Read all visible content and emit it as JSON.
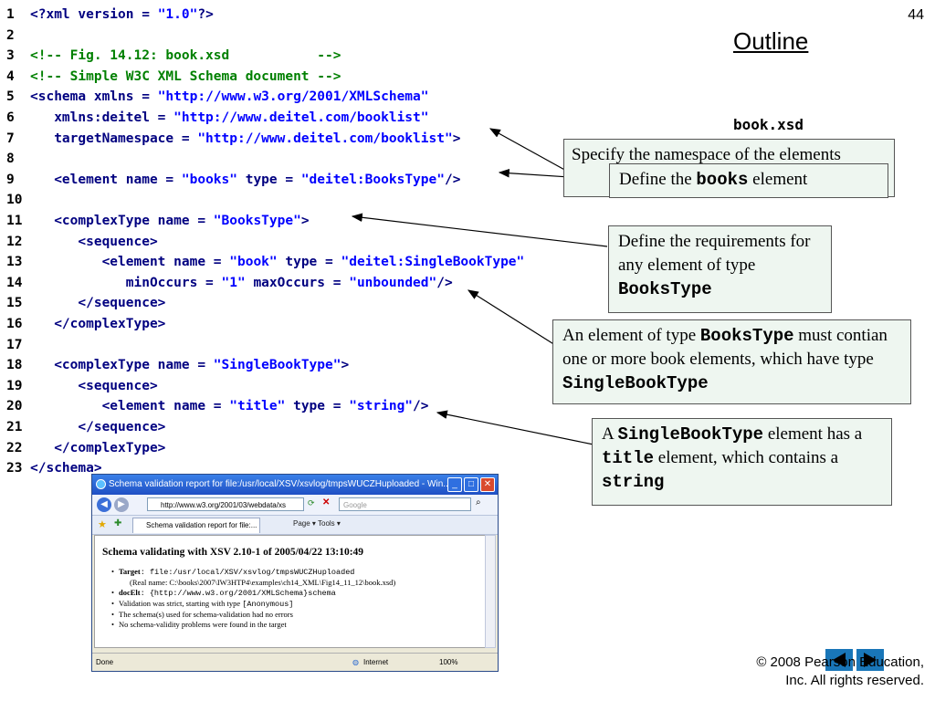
{
  "page_number": "44",
  "outline_title": "Outline",
  "file_name": "book.xsd",
  "code_lines": [
    {
      "n": "1",
      "t": "<?xml version = \"1.0\"?>"
    },
    {
      "n": "2",
      "t": ""
    },
    {
      "n": "3",
      "t": "<!-- Fig. 14.12: book.xsd           -->"
    },
    {
      "n": "4",
      "t": "<!-- Simple W3C XML Schema document -->"
    },
    {
      "n": "5",
      "t": "<schema xmlns = \"http://www.w3.org/2001/XMLSchema\""
    },
    {
      "n": "6",
      "t": "   xmlns:deitel = \"http://www.deitel.com/booklist\""
    },
    {
      "n": "7",
      "t": "   targetNamespace = \"http://www.deitel.com/booklist\">"
    },
    {
      "n": "8",
      "t": ""
    },
    {
      "n": "9",
      "t": "   <element name = \"books\" type = \"deitel:BooksType\"/>"
    },
    {
      "n": "10",
      "t": ""
    },
    {
      "n": "11",
      "t": "   <complexType name = \"BooksType\">"
    },
    {
      "n": "12",
      "t": "      <sequence>"
    },
    {
      "n": "13",
      "t": "         <element name = \"book\" type = \"deitel:SingleBookType\""
    },
    {
      "n": "14",
      "t": "            minOccurs = \"1\" maxOccurs = \"unbounded\"/>"
    },
    {
      "n": "15",
      "t": "      </sequence>"
    },
    {
      "n": "16",
      "t": "   </complexType>"
    },
    {
      "n": "17",
      "t": ""
    },
    {
      "n": "18",
      "t": "   <complexType name = \"SingleBookType\">"
    },
    {
      "n": "19",
      "t": "      <sequence>"
    },
    {
      "n": "20",
      "t": "         <element name = \"title\" type = \"string\"/>"
    },
    {
      "n": "21",
      "t": "      </sequence>"
    },
    {
      "n": "22",
      "t": "   </complexType>"
    },
    {
      "n": "23",
      "t": "</schema>"
    }
  ],
  "callouts": {
    "namespace": "Specify the namespace of the elements",
    "books_element": {
      "before": "Define the ",
      "code": "books",
      "after": " element"
    },
    "bookstype": {
      "before": "Define the requirements for any element of type ",
      "code": "BooksType"
    },
    "contain": {
      "p1": "An element of type ",
      "c1": "BooksType",
      "p2": " must contian one or more book elements, which have type ",
      "c2": "SingleBookType"
    },
    "singlebook": {
      "p0": "A ",
      "c1": "SingleBookType",
      "p1": " element has a ",
      "c2": "title",
      "p2": " element, which contains a ",
      "c3": "string"
    }
  },
  "browser": {
    "title": "Schema validation report for file:/usr/local/XSV/xsvlog/tmpsWUCZHuploaded - Win...",
    "address": "http://www.w3.org/2001/03/webdata/xs",
    "search_placeholder": "Google",
    "tab_label": "Schema validation report for file:...",
    "tools": "Page ▾  Tools ▾",
    "heading": "Schema validating with XSV 2.10-1 of 2005/04/22 13:10:49",
    "items": [
      {
        "label": "Target",
        "value": ": file:/usr/local/XSV/xsvlog/tmpsWUCZHuploaded"
      },
      {
        "sub": "(Real name: C:\\books\\2007\\IW3HTP4\\examples\\ch14_XML\\Fig14_11_12\\book.xsd)"
      },
      {
        "label": "docElt",
        "value": ": {http://www.w3.org/2001/XMLSchema}schema"
      },
      {
        "text": "Validation was strict, starting with type ",
        "mono": "[Anonymous]"
      },
      {
        "text": "The schema(s) used for schema-validation had no errors"
      },
      {
        "text": "No schema-validity problems were found in the target"
      }
    ],
    "status_done": "Done",
    "status_zone": "Internet",
    "status_zoom": "100%"
  },
  "copyright": [
    "© 2008 Pearson Education,",
    "Inc.  All rights reserved."
  ]
}
